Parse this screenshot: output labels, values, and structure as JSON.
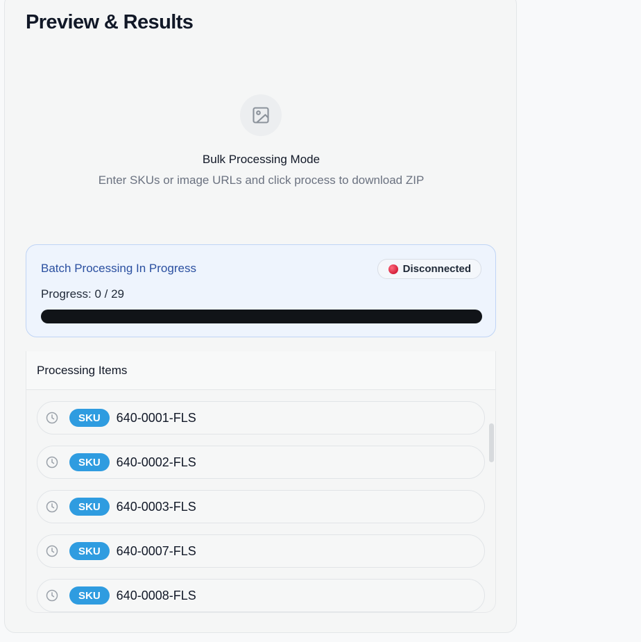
{
  "header": {
    "title": "Preview & Results"
  },
  "empty_state": {
    "icon": "image-icon",
    "title": "Bulk Processing Mode",
    "description": "Enter SKUs or image URLs and click process to download ZIP"
  },
  "batch": {
    "title": "Batch Processing In Progress",
    "status": {
      "label": "Disconnected",
      "color": "#e11d48"
    },
    "progress_text": "Progress: 0 / 29",
    "progress_fraction": 0
  },
  "items_panel": {
    "title": "Processing Items",
    "items": [
      {
        "badge": "SKU",
        "code": "640-0001-FLS",
        "icon": "clock-icon"
      },
      {
        "badge": "SKU",
        "code": "640-0002-FLS",
        "icon": "clock-icon"
      },
      {
        "badge": "SKU",
        "code": "640-0003-FLS",
        "icon": "clock-icon"
      },
      {
        "badge": "SKU",
        "code": "640-0007-FLS",
        "icon": "clock-icon"
      },
      {
        "badge": "SKU",
        "code": "640-0008-FLS",
        "icon": "clock-icon"
      }
    ]
  },
  "colors": {
    "accent_blue": "#2f9ce0",
    "batch_title": "#2a4fa0",
    "progress_track": "#111418"
  }
}
